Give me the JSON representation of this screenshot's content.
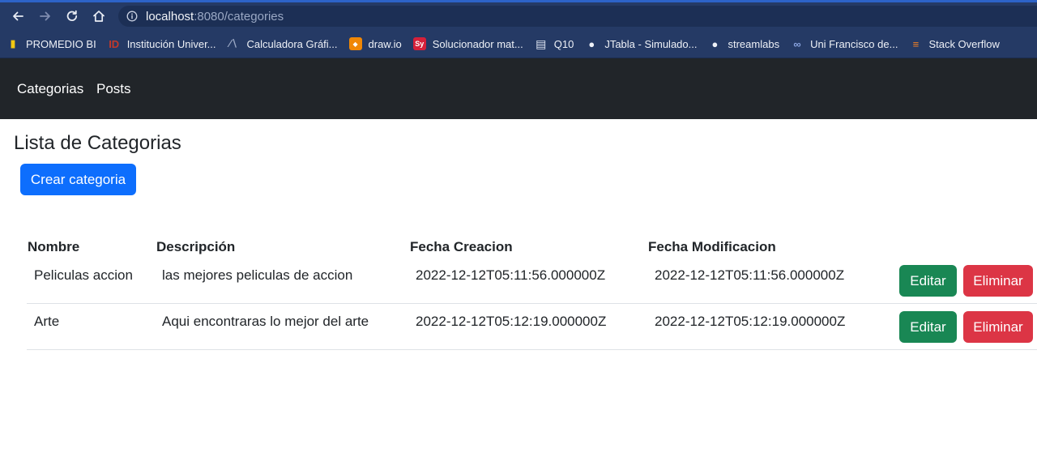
{
  "browser": {
    "url_host": "localhost",
    "url_path": ":8080/categories",
    "bookmarks": [
      {
        "label": "PROMEDIO BI",
        "icon": "powerbi-icon",
        "color": "#f2c811"
      },
      {
        "label": "Institución Univer...",
        "icon": "university-icon",
        "color": "#c0392b"
      },
      {
        "label": "Calculadora Gráfi...",
        "icon": "graph-calculator-icon",
        "color": "#9aa8c4"
      },
      {
        "label": "draw.io",
        "icon": "drawio-icon",
        "color": "#f08705"
      },
      {
        "label": "Solucionador mat...",
        "icon": "symbolab-icon",
        "color": "#d6203a"
      },
      {
        "label": "Q10",
        "icon": "document-icon",
        "color": "#dfe6f3"
      },
      {
        "label": "JTabla - Simulado...",
        "icon": "globe-icon",
        "color": "#eef1f7"
      },
      {
        "label": "streamlabs",
        "icon": "globe-icon",
        "color": "#eef1f7"
      },
      {
        "label": "Uni Francisco de...",
        "icon": "link-icon",
        "color": "#8aa4e0"
      },
      {
        "label": "Stack Overflow",
        "icon": "stackoverflow-icon",
        "color": "#f48024"
      }
    ]
  },
  "navbar": {
    "items": [
      {
        "label": "Categorias"
      },
      {
        "label": "Posts"
      }
    ]
  },
  "page": {
    "title": "Lista de Categorias",
    "create_button": "Crear categoria"
  },
  "table": {
    "headers": [
      "Nombre",
      "Descripción",
      "Fecha Creacion",
      "Fecha Modificacion"
    ],
    "rows": [
      {
        "nombre": "Peliculas accion",
        "descripcion": "las mejores peliculas de accion",
        "fecha_creacion": "2022-12-12T05:11:56.000000Z",
        "fecha_modificacion": "2022-12-12T05:11:56.000000Z",
        "edit_label": "Editar",
        "delete_label": "Eliminar"
      },
      {
        "nombre": "Arte",
        "descripcion": "Aqui encontraras lo mejor del arte",
        "fecha_creacion": "2022-12-12T05:12:19.000000Z",
        "fecha_modificacion": "2022-12-12T05:12:19.000000Z",
        "edit_label": "Editar",
        "delete_label": "Eliminar"
      }
    ]
  },
  "colors": {
    "primary": "#0d6efd",
    "success": "#198754",
    "danger": "#dc3545",
    "navbar": "#212529",
    "browser_chrome": "#253a65"
  }
}
